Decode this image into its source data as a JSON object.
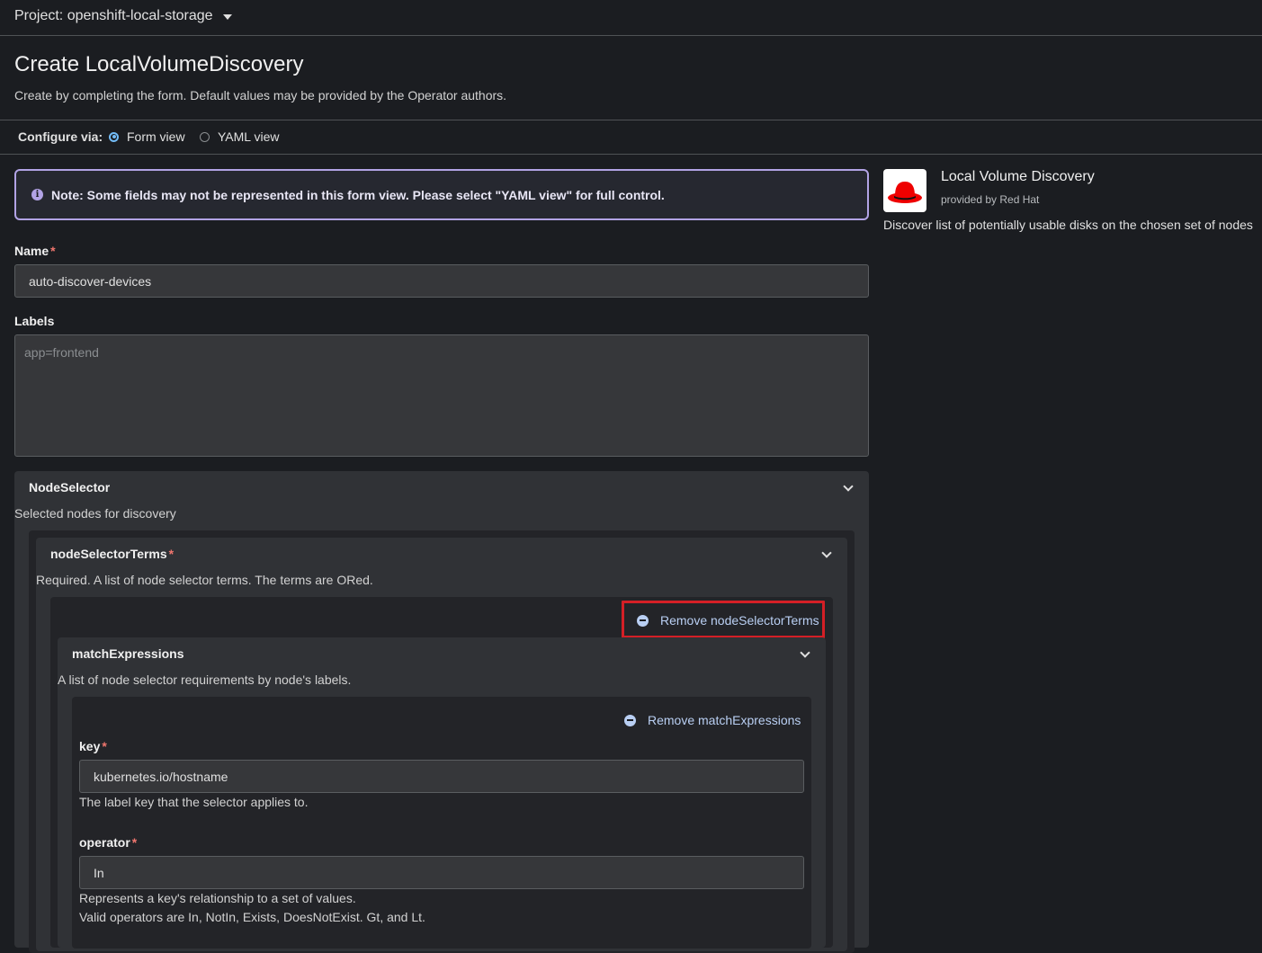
{
  "project": {
    "label": "Project: openshift-local-storage"
  },
  "page": {
    "title": "Create LocalVolumeDiscovery",
    "description": "Create by completing the form. Default values may be provided by the Operator authors."
  },
  "configure": {
    "label": "Configure via:",
    "options": [
      {
        "label": "Form view",
        "checked": true
      },
      {
        "label": "YAML view",
        "checked": false
      }
    ]
  },
  "alert": {
    "text": "Note: Some fields may not be represented in this form view. Please select \"YAML view\" for full control."
  },
  "form": {
    "name": {
      "label": "Name",
      "required_mark": "*",
      "value": "auto-discover-devices"
    },
    "labels": {
      "label": "Labels",
      "placeholder": "app=frontend"
    },
    "node_selector": {
      "title": "NodeSelector",
      "description": "Selected nodes for discovery",
      "node_selector_terms": {
        "title": "nodeSelectorTerms",
        "required_mark": "*",
        "description": "Required. A list of node selector terms. The terms are ORed.",
        "remove_label": "Remove nodeSelectorTerms",
        "match_expressions": {
          "title": "matchExpressions",
          "description": "A list of node selector requirements by node's labels.",
          "remove_label": "Remove matchExpressions",
          "key": {
            "label": "key",
            "required_mark": "*",
            "value": "kubernetes.io/hostname",
            "help": "The label key that the selector applies to."
          },
          "operator": {
            "label": "operator",
            "required_mark": "*",
            "value": "In",
            "help_line1": "Represents a key's relationship to a set of values.",
            "help_line2": "Valid operators are In, NotIn, Exists, DoesNotExist. Gt, and Lt."
          }
        }
      }
    }
  },
  "sidebar": {
    "title": "Local Volume Discovery",
    "provider": "provided by Red Hat",
    "description": "Discover list of potentially usable disks on the chosen set of nodes"
  },
  "colors": {
    "background": "#1b1d21",
    "alert_border": "#b2a3e5",
    "link": "#b9cff3",
    "required": "#f0766e",
    "highlight": "#d41f26",
    "brand_red": "#ee0000"
  }
}
